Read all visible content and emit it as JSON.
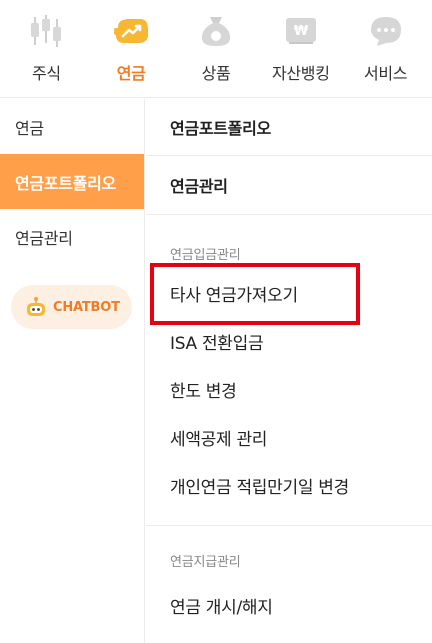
{
  "top_tabs": [
    {
      "label": "주식",
      "icon": "candlestick-chart-icon",
      "active": false
    },
    {
      "label": "연금",
      "icon": "piggy-bank-icon",
      "active": true
    },
    {
      "label": "상품",
      "icon": "money-bag-icon",
      "active": false
    },
    {
      "label": "자산뱅킹",
      "icon": "bank-card-won-icon",
      "active": false
    },
    {
      "label": "서비스",
      "icon": "speech-bubble-icon",
      "active": false
    }
  ],
  "sidebar": {
    "items": [
      {
        "label": "연금",
        "active": false
      },
      {
        "label": "연금포트폴리오",
        "active": true
      },
      {
        "label": "연금관리",
        "active": false
      }
    ],
    "chatbot_label": "CHATBOT"
  },
  "main": {
    "section_portfolio": "연금포트폴리오",
    "section_manage": "연금관리",
    "group_deposit": {
      "title": "연금입금관리",
      "items": [
        "타사 연금가져오기",
        "ISA 전환입금",
        "한도 변경",
        "세액공제 관리",
        "개인연금 적립만기일 변경"
      ]
    },
    "group_payout": {
      "title": "연금지급관리",
      "items": [
        "연금 개시/해지"
      ]
    }
  },
  "colors": {
    "accent": "#ee7d25",
    "sidebar_active_bg": "#ff9f4a",
    "highlight_box": "#e60012"
  }
}
